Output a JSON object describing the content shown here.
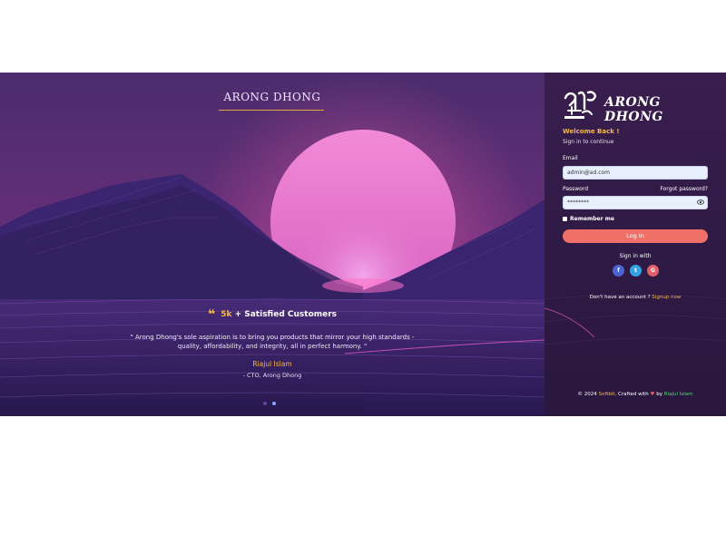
{
  "hero": {
    "brand_title": "ARONG DHONG",
    "stat_number": "5k",
    "stat_text": " + Satisfied Customers",
    "quote_icon": "quote-icon",
    "testimonial": "\" Arong Dhong's sole aspiration is to bring you products that mirror your high standards - quality, affordability, and integrity, all in perfect harmony. \"",
    "author": "Riajul Islam",
    "role": "- CTO, Arong Dhong",
    "carousel_active_index": 1,
    "colors": {
      "accent": "#f5b84a",
      "sky_top": "#4a2d6b",
      "sun": "#e97ac4",
      "mountain": "#3b2570"
    }
  },
  "login": {
    "logo_text": "ARONG DHONG",
    "welcome": "Welcome Back !",
    "subtitle": "Sign in to continue",
    "email_label": "Email",
    "email_value": "admin@ad.com",
    "password_label": "Password",
    "forgot_label": "Forgot password?",
    "password_value": "********",
    "remember_label": "Remember me",
    "login_button": "Log In",
    "signin_with": "Sign in with",
    "social": {
      "facebook": "f",
      "twitter": "t",
      "google": "G"
    },
    "signup_prompt": "Don't have an account ? ",
    "signup_link": "Signup now",
    "colors": {
      "button": "#f07067",
      "accent": "#f5b84a"
    }
  },
  "footer": {
    "copyright": "© 2024 ",
    "brand": "Softbit",
    "crafted": ". Crafted with ",
    "heart": "♥",
    "by": " by ",
    "author": "Riajul Islam"
  }
}
